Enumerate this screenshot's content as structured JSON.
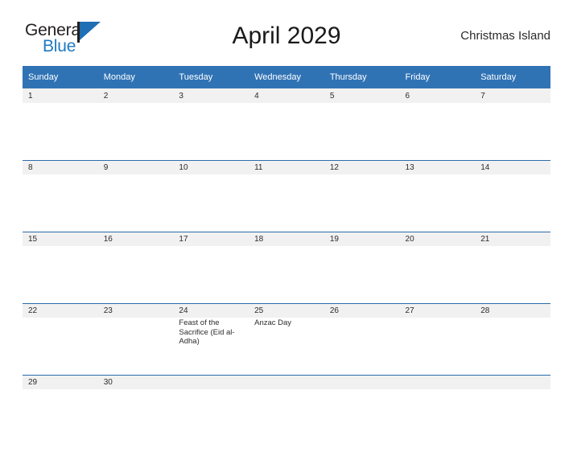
{
  "logo": {
    "word_one": "General",
    "word_two": "Blue",
    "flag_icon": "blue-flag-triangle-icon",
    "blue_hex": "#1f7ac1"
  },
  "header": {
    "title": "April 2029",
    "subtitle": "Christmas Island"
  },
  "calendar": {
    "header_bg_hex": "#3073b5",
    "date_band_bg_hex": "#f1f1f1",
    "rule_hex": "#2b6cab",
    "weekday_headers": [
      "Sunday",
      "Monday",
      "Tuesday",
      "Wednesday",
      "Thursday",
      "Friday",
      "Saturday"
    ],
    "weeks": [
      {
        "dates": [
          "1",
          "2",
          "3",
          "4",
          "5",
          "6",
          "7"
        ],
        "events": [
          "",
          "",
          "",
          "",
          "",
          "",
          ""
        ]
      },
      {
        "dates": [
          "8",
          "9",
          "10",
          "11",
          "12",
          "13",
          "14"
        ],
        "events": [
          "",
          "",
          "",
          "",
          "",
          "",
          ""
        ]
      },
      {
        "dates": [
          "15",
          "16",
          "17",
          "18",
          "19",
          "20",
          "21"
        ],
        "events": [
          "",
          "",
          "",
          "",
          "",
          "",
          ""
        ]
      },
      {
        "dates": [
          "22",
          "23",
          "24",
          "25",
          "26",
          "27",
          "28"
        ],
        "events": [
          "",
          "",
          "Feast of the Sacrifice (Eid al-Adha)",
          "Anzac Day",
          "",
          "",
          ""
        ]
      },
      {
        "dates": [
          "29",
          "30",
          "",
          "",
          "",
          "",
          ""
        ],
        "events": [
          "",
          "",
          "",
          "",
          "",
          "",
          ""
        ]
      }
    ]
  }
}
